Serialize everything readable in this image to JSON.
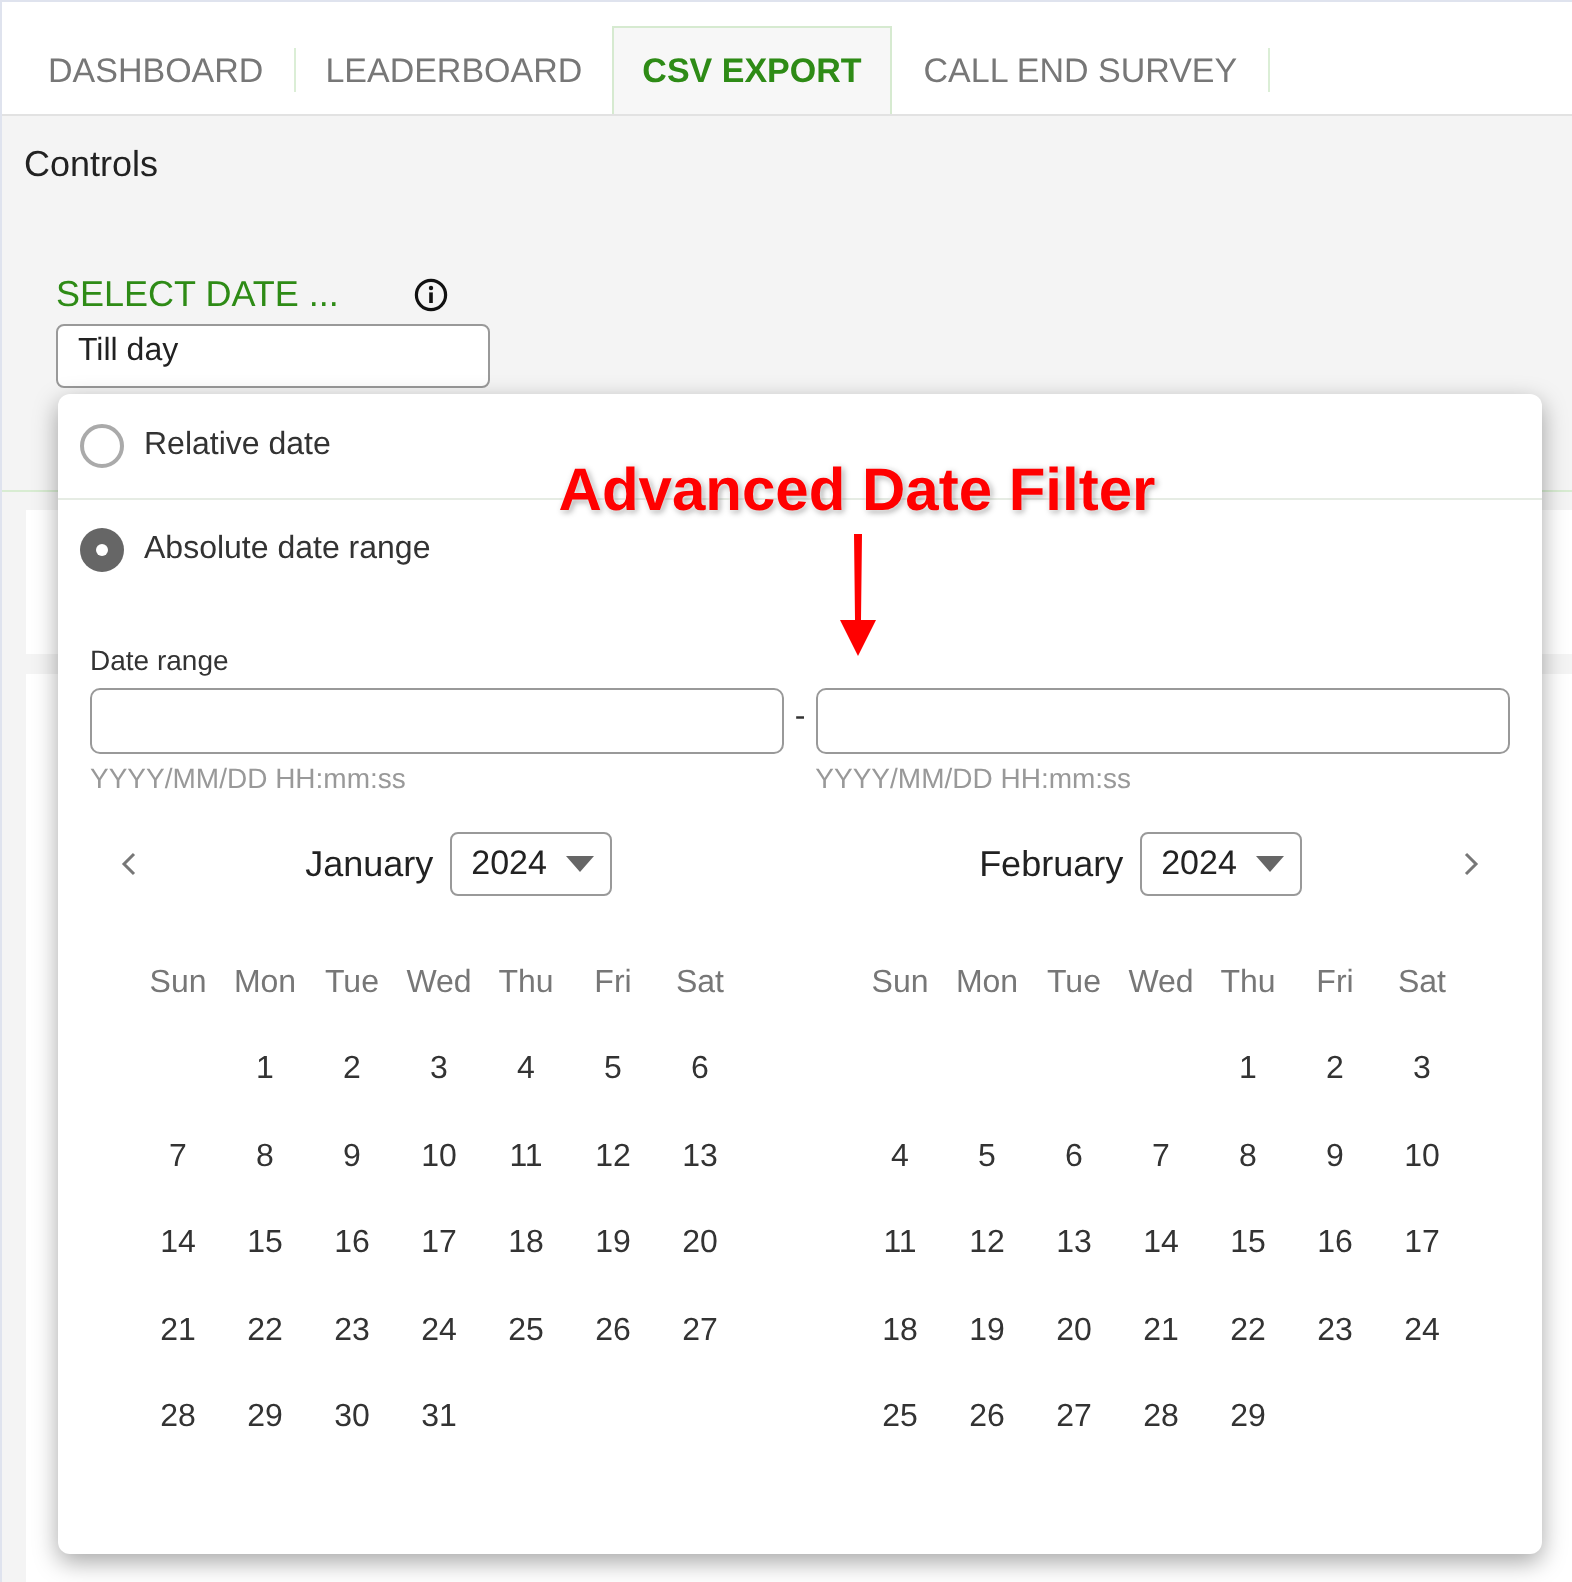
{
  "tabs": [
    {
      "label": "DASHBOARD",
      "selected": false
    },
    {
      "label": "LEADERBOARD",
      "selected": false
    },
    {
      "label": "CSV EXPORT",
      "selected": true
    },
    {
      "label": "CALL END SURVEY",
      "selected": false
    }
  ],
  "section_title": "Controls",
  "date_select": {
    "label": "SELECT DATE ...",
    "value": "Till day"
  },
  "date_filter": {
    "options": [
      {
        "label": "Relative date",
        "selected": false
      },
      {
        "label": "Absolute date range",
        "selected": true
      }
    ],
    "range_label": "Date range",
    "separator": "-",
    "start": {
      "placeholder": "YYYY/MM/DD HH:mm:ss"
    },
    "end": {
      "placeholder": "YYYY/MM/DD HH:mm:ss"
    },
    "months": [
      {
        "name": "January",
        "year": "2024",
        "weekdays": [
          "Sun",
          "Mon",
          "Tue",
          "Wed",
          "Thu",
          "Fri",
          "Sat"
        ],
        "weeks": [
          [
            {
              "kind": "blank"
            },
            {
              "kind": "day",
              "day": "1"
            },
            {
              "kind": "day",
              "day": "2"
            },
            {
              "kind": "day",
              "day": "3"
            },
            {
              "kind": "day",
              "day": "4"
            },
            {
              "kind": "day",
              "day": "5"
            },
            {
              "kind": "day",
              "day": "6"
            }
          ],
          [
            {
              "kind": "day",
              "day": "7"
            },
            {
              "kind": "day",
              "day": "8"
            },
            {
              "kind": "day",
              "day": "9"
            },
            {
              "kind": "day",
              "day": "10"
            },
            {
              "kind": "day",
              "day": "11"
            },
            {
              "kind": "day",
              "day": "12"
            },
            {
              "kind": "day",
              "day": "13"
            }
          ],
          [
            {
              "kind": "day",
              "day": "14"
            },
            {
              "kind": "day",
              "day": "15"
            },
            {
              "kind": "day",
              "day": "16"
            },
            {
              "kind": "day",
              "day": "17"
            },
            {
              "kind": "day",
              "day": "18"
            },
            {
              "kind": "day",
              "day": "19"
            },
            {
              "kind": "day",
              "day": "20"
            }
          ],
          [
            {
              "kind": "day",
              "day": "21"
            },
            {
              "kind": "day",
              "day": "22"
            },
            {
              "kind": "day",
              "day": "23"
            },
            {
              "kind": "day",
              "day": "24"
            },
            {
              "kind": "day",
              "day": "25"
            },
            {
              "kind": "day",
              "day": "26"
            },
            {
              "kind": "day",
              "day": "27"
            }
          ],
          [
            {
              "kind": "day",
              "day": "28"
            },
            {
              "kind": "day",
              "day": "29"
            },
            {
              "kind": "day",
              "day": "30"
            },
            {
              "kind": "day",
              "day": "31"
            }
          ]
        ]
      },
      {
        "name": "February",
        "year": "2024",
        "weekdays": [
          "Sun",
          "Mon",
          "Tue",
          "Wed",
          "Thu",
          "Fri",
          "Sat"
        ],
        "weeks": [
          [
            {
              "kind": "blank"
            },
            {
              "kind": "blank"
            },
            {
              "kind": "blank"
            },
            {
              "kind": "blank"
            },
            {
              "kind": "day",
              "day": "1"
            },
            {
              "kind": "day",
              "day": "2"
            },
            {
              "kind": "day",
              "day": "3"
            }
          ],
          [
            {
              "kind": "day",
              "day": "4"
            },
            {
              "kind": "day",
              "day": "5"
            },
            {
              "kind": "day",
              "day": "6"
            },
            {
              "kind": "day",
              "day": "7"
            },
            {
              "kind": "day",
              "day": "8"
            },
            {
              "kind": "day",
              "day": "9"
            },
            {
              "kind": "day",
              "day": "10"
            }
          ],
          [
            {
              "kind": "day",
              "day": "11"
            },
            {
              "kind": "day",
              "day": "12"
            },
            {
              "kind": "day",
              "day": "13"
            },
            {
              "kind": "day",
              "day": "14"
            },
            {
              "kind": "day",
              "day": "15"
            },
            {
              "kind": "day",
              "day": "16"
            },
            {
              "kind": "day",
              "day": "17"
            }
          ],
          [
            {
              "kind": "day",
              "day": "18"
            },
            {
              "kind": "day",
              "day": "19"
            },
            {
              "kind": "day",
              "day": "20"
            },
            {
              "kind": "day",
              "day": "21"
            },
            {
              "kind": "day",
              "day": "22"
            },
            {
              "kind": "day",
              "day": "23"
            },
            {
              "kind": "day",
              "day": "24"
            }
          ],
          [
            {
              "kind": "day",
              "day": "25"
            },
            {
              "kind": "day",
              "day": "26"
            },
            {
              "kind": "day",
              "day": "27"
            },
            {
              "kind": "day",
              "day": "28"
            },
            {
              "kind": "day",
              "day": "29"
            }
          ]
        ]
      }
    ]
  },
  "annotation": {
    "text": "Advanced Date Filter"
  }
}
